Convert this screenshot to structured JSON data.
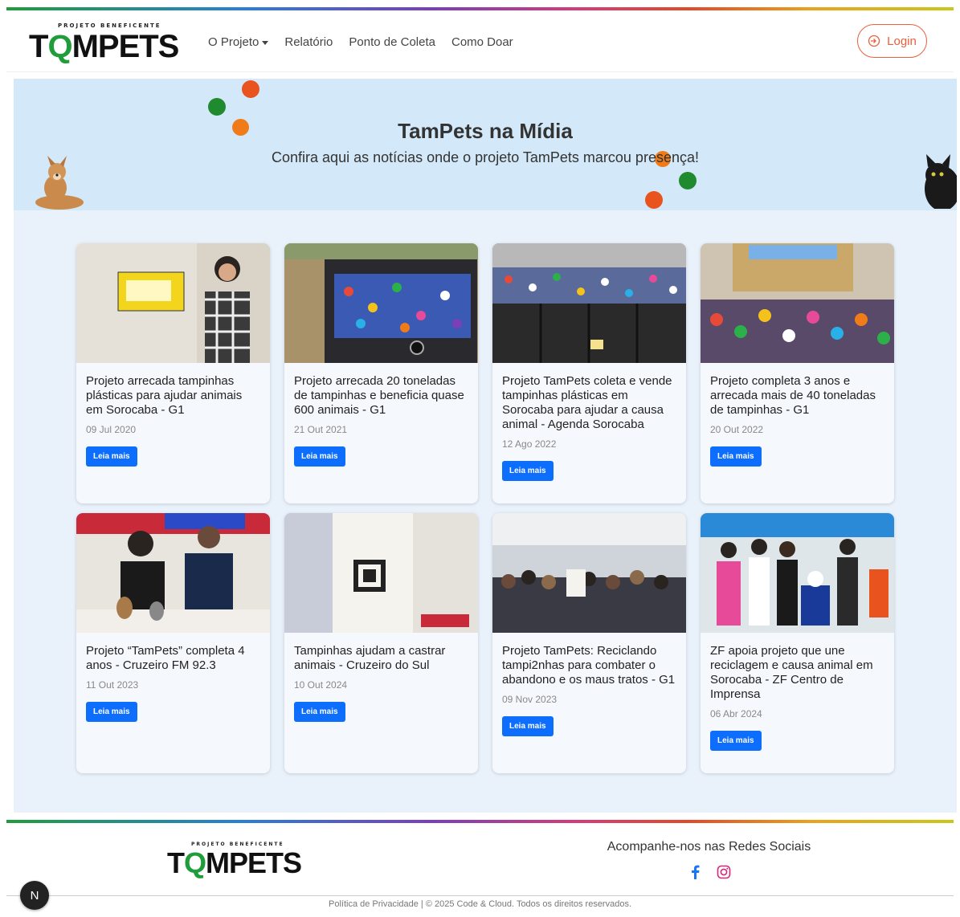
{
  "brand": {
    "logo_prefix": "PROJETO BENEFICENTE",
    "logo_word_a": "T",
    "logo_word_q": "Q",
    "logo_word_b": "MPETS",
    "accent_color": "#e8603c",
    "green": "#1f9d3a"
  },
  "nav": {
    "items": [
      {
        "label": "O Projeto",
        "dropdown": true
      },
      {
        "label": "Relatório"
      },
      {
        "label": "Ponto de Coleta"
      },
      {
        "label": "Como Doar"
      }
    ],
    "login_label": "Login"
  },
  "hero": {
    "title": "TamPets na Mídia",
    "subtitle": "Confira aqui as notícias onde o projeto TamPets marcou presença!"
  },
  "cards": [
    {
      "title": "Projeto arrecada tampinhas plásticas para ajudar animais em Sorocaba - G1",
      "date": "09 Jul 2020",
      "button": "Leia mais"
    },
    {
      "title": "Projeto arrecada 20 toneladas de tampinhas e beneficia quase 600 animais - G1",
      "date": "21 Out 2021",
      "button": "Leia mais"
    },
    {
      "title": "Projeto TamPets coleta e vende tampinhas plásticas em Sorocaba para ajudar a causa animal - Agenda Sorocaba",
      "date": "12 Ago 2022",
      "button": "Leia mais"
    },
    {
      "title": "Projeto completa 3 anos e arrecada mais de 40 toneladas de tampinhas - G1",
      "date": "20 Out 2022",
      "button": "Leia mais"
    },
    {
      "title": "Projeto “TamPets” completa 4 anos - Cruzeiro FM 92.3",
      "date": "11 Out 2023",
      "button": "Leia mais"
    },
    {
      "title": "Tampinhas ajudam a castrar animais - Cruzeiro do Sul",
      "date": "10 Out 2024",
      "button": "Leia mais"
    },
    {
      "title": "Projeto TamPets: Reciclando tampi2nhas para combater o abandono e os maus tratos - G1",
      "date": "09 Nov 2023",
      "button": "Leia mais"
    },
    {
      "title": "ZF apoia projeto que une reciclagem e causa animal em Sorocaba - ZF Centro de Imprensa",
      "date": "06 Abr 2024",
      "button": "Leia mais"
    }
  ],
  "footer": {
    "social_title": "Acompanhe-nos nas Redes Sociais",
    "social_icons": [
      "facebook-icon",
      "instagram-icon"
    ],
    "copyright": "Política de Privacidade | © 2025 Code & Cloud. Todos os direitos reservados.",
    "badge": "N"
  }
}
